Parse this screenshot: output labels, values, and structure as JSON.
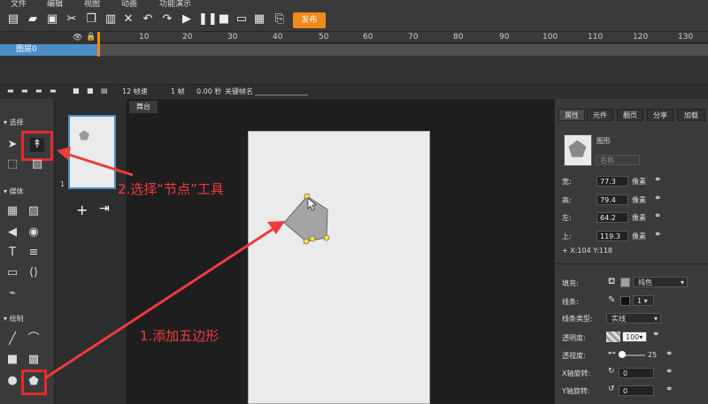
{
  "menu": [
    "文件",
    "编辑",
    "视图",
    "动画",
    "功能演示"
  ],
  "toolbar": {
    "publish": "发布"
  },
  "timeline": {
    "ruler": [
      "10",
      "20",
      "30",
      "40",
      "50",
      "60",
      "70",
      "80",
      "90",
      "100",
      "110",
      "120",
      "130"
    ],
    "layer": "图层0",
    "fps": "12 帧速",
    "frame": "1 帧",
    "time": "0.00 秒",
    "keyframe": "关键帧名"
  },
  "left": {
    "select": "选择",
    "media": "媒体",
    "draw": "绘制"
  },
  "thumb": {
    "number": "1"
  },
  "stage": {
    "tab": "舞台"
  },
  "right": {
    "tabs": [
      "属性",
      "元件",
      "翻页",
      "分享",
      "加载"
    ],
    "shape_label": "图形",
    "name_placeholder": "名称",
    "width_label": "宽:",
    "width": "77.3",
    "height_label": "高:",
    "height": "79.4",
    "left_label": "左:",
    "left_val": "64.2",
    "top_label": "上:",
    "top_val": "119.3",
    "unit": "像素",
    "coords": "+ X:104   Y:118",
    "fill_label": "填充:",
    "fill_type": "纯色",
    "stroke_label": "线条:",
    "stroke_width": "1",
    "stroke_type_label": "线条类型:",
    "stroke_type": "实线",
    "opacity_label": "透明度:",
    "opacity": "100",
    "perspective_label": "透视度:",
    "perspective": "25",
    "xrot_label": "X轴旋转:",
    "xrot": "0",
    "yrot_label": "Y轴旋转:",
    "yrot": "0"
  },
  "callouts": {
    "step1": "1.添加五边形",
    "step2": "2.选择“节点”工具"
  },
  "colors": {
    "accent": "#f08a1c",
    "annotation": "#ef3b3b",
    "selection": "#4b8ec8"
  }
}
